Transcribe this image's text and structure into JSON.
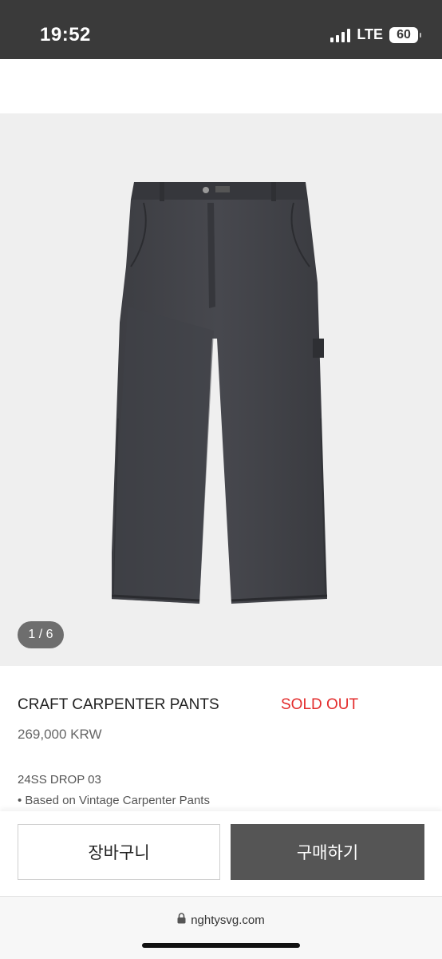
{
  "status_bar": {
    "time": "19:52",
    "network": "LTE",
    "battery": "60"
  },
  "gallery": {
    "counter": "1 / 6",
    "background_color": "#efefef"
  },
  "product": {
    "name": "CRAFT CARPENTER PANTS",
    "status": "SOLD OUT",
    "status_color": "#e32b2b",
    "price": "269,000 KRW",
    "drop": "24SS DROP 03",
    "description": "• Based on Vintage Carpenter Pants"
  },
  "actions": {
    "cart_label": "장바구니",
    "buy_label": "구매하기"
  },
  "browser": {
    "url": "nghtysvg.com"
  }
}
